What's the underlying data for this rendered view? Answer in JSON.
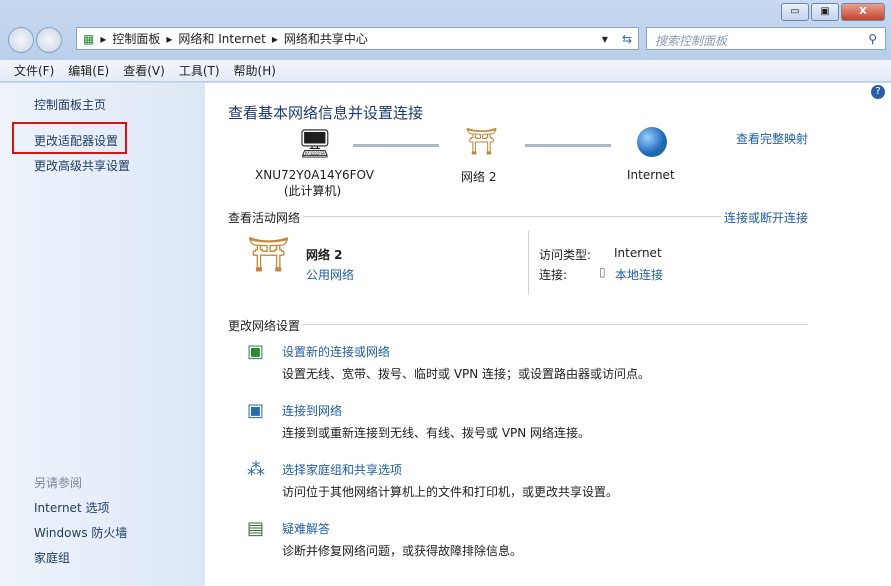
{
  "address": {
    "crumbs": [
      "控制面板",
      "网络和 Internet",
      "网络和共享中心"
    ],
    "search_placeholder": "搜索控制面板"
  },
  "menu": [
    "文件(F)",
    "编辑(E)",
    "查看(V)",
    "工具(T)",
    "帮助(H)"
  ],
  "sidebar": {
    "items": [
      "控制面板主页",
      "更改适配器设置",
      "更改高级共享设置"
    ],
    "see_also": "另请参阅",
    "also_items": [
      "Internet 选项",
      "Windows 防火墙",
      "家庭组"
    ]
  },
  "main": {
    "title": "查看基本网络信息并设置连接",
    "full_map": "查看完整映射",
    "computer": "XNU72Y0A14Y6FOV",
    "computer_sub": "(此计算机)",
    "network": "网络  2",
    "internet": "Internet",
    "active_header": "查看活动网络",
    "connect_link": "连接或断开连接",
    "net_name": "网络  2",
    "net_type": "公用网络",
    "access_label": "访问类型:",
    "access_value": "Internet",
    "conn_label": "连接:",
    "conn_value": "本地连接",
    "change_header": "更改网络设置",
    "tasks": [
      {
        "title": "设置新的连接或网络",
        "desc": "设置无线、宽带、拨号、临时或 VPN 连接；或设置路由器或访问点。"
      },
      {
        "title": "连接到网络",
        "desc": "连接到或重新连接到无线、有线、拨号或 VPN 网络连接。"
      },
      {
        "title": "选择家庭组和共享选项",
        "desc": "访问位于其他网络计算机上的文件和打印机，或更改共享设置。"
      },
      {
        "title": "疑难解答",
        "desc": "诊断并修复网络问题，或获得故障排除信息。"
      }
    ]
  }
}
